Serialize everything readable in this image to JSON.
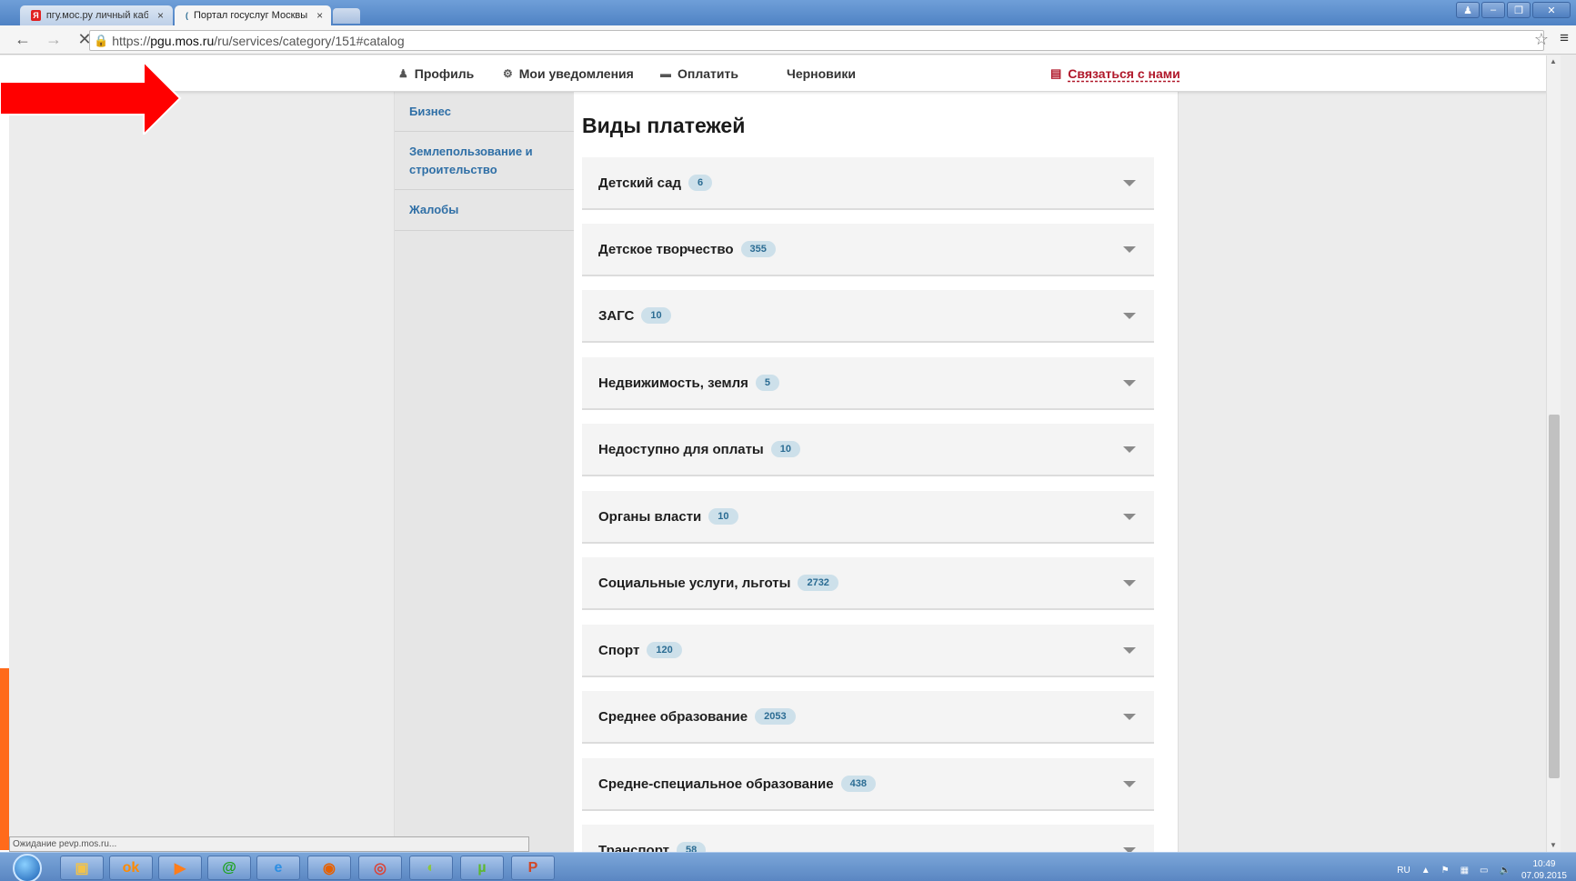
{
  "browser": {
    "tabs": [
      {
        "title": "пгу.мос.ру личный кабин",
        "favicon": "Я",
        "active": false
      },
      {
        "title": "Портал госуслуг Москвы",
        "favicon": "(",
        "active": true
      }
    ],
    "url_prefix": "https://",
    "url_host": "pgu.mos.ru",
    "url_path": "/ru/services/category/151#catalog",
    "status_text": "Ожидание pevp.mos.ru..."
  },
  "topnav": {
    "profile": "Профиль",
    "notifications": "Мои уведомления",
    "pay": "Оплатить",
    "drafts": "Черновики",
    "contact": "Связаться с нами"
  },
  "sidebar": {
    "items": [
      {
        "label": "Бизнес"
      },
      {
        "label": "Землепользование и строительство"
      },
      {
        "label": "Жалобы"
      }
    ]
  },
  "main": {
    "title": "Виды платежей",
    "rows": [
      {
        "label": "Детский сад",
        "count": "6"
      },
      {
        "label": "Детское творчество",
        "count": "355"
      },
      {
        "label": "ЗАГС",
        "count": "10"
      },
      {
        "label": "Недвижимость, земля",
        "count": "5"
      },
      {
        "label": "Недоступно для оплаты",
        "count": "10"
      },
      {
        "label": "Органы власти",
        "count": "10"
      },
      {
        "label": "Социальные услуги, льготы",
        "count": "2732"
      },
      {
        "label": "Спорт",
        "count": "120"
      },
      {
        "label": "Среднее образование",
        "count": "2053"
      },
      {
        "label": "Средне-специальное образование",
        "count": "438"
      },
      {
        "label": "Транспорт",
        "count": "58"
      }
    ]
  },
  "taskbar": {
    "lang": "RU",
    "time": "10:49",
    "date": "07.09.2015"
  },
  "colors": {
    "link": "#2f6fa6",
    "contact": "#b0182a",
    "badge_bg": "#cde0ea",
    "arrow": "#ff0000"
  }
}
